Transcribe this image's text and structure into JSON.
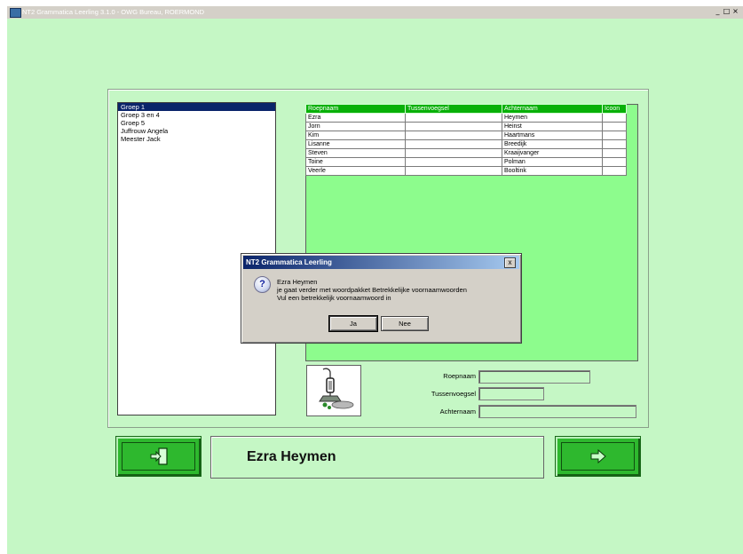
{
  "window": {
    "title": "NT2 Grammatica Leerling  3.1.0 - OWG Bureau, ROERMOND",
    "minimize_glyph": "_",
    "maximize_glyph": "□",
    "close_glyph": "×"
  },
  "groups": [
    "Groep 1",
    "Groep 3 en 4",
    "Groep 5",
    "Juffrouw Angela",
    "Meester Jack"
  ],
  "selected_group": "Groep 1",
  "students_table": {
    "columns": [
      "Roepnaam",
      "Tussenvoegsel",
      "Achternaam",
      "Icoon"
    ],
    "rows": [
      [
        "Ezra",
        "",
        "Heymen",
        ""
      ],
      [
        "Jorn",
        "",
        "Heinst",
        ""
      ],
      [
        "Kim",
        "",
        "Haartmans",
        ""
      ],
      [
        "Lisanne",
        "",
        "Breedijk",
        ""
      ],
      [
        "Steven",
        "",
        "Kraaijvanger",
        ""
      ],
      [
        "Toine",
        "",
        "Polman",
        ""
      ],
      [
        "Veerle",
        "",
        "Booltink",
        ""
      ]
    ]
  },
  "fields": {
    "roepnaam_label": "Roepnaam",
    "roepnaam_value": "",
    "tussenvoegsel_label": "Tussenvoegsel",
    "tussenvoegsel_value": "",
    "achternaam_label": "Achternaam",
    "achternaam_value": ""
  },
  "current_student": "Ezra Heymen",
  "dialog": {
    "title": "NT2 Grammatica Leerling",
    "line1": "Ezra Heymen",
    "line2": "je gaat verder met woordpakket Betrekkelijke voornaamwoorden",
    "line3": "Vul een betrekkelijk voornaamwoord in",
    "yes_label": "Ja",
    "no_label": "Nee",
    "question_glyph": "?",
    "close_glyph": "x"
  },
  "icons": {
    "exit": "exit-door-icon",
    "next": "arrow-right-icon",
    "photo": "microphone-icon"
  },
  "colors": {
    "background": "#c5f7c5",
    "table_header": "#08b008",
    "student_area": "#8dfc8d",
    "selection": "#0a246a",
    "button_green": "#2eb82e"
  }
}
